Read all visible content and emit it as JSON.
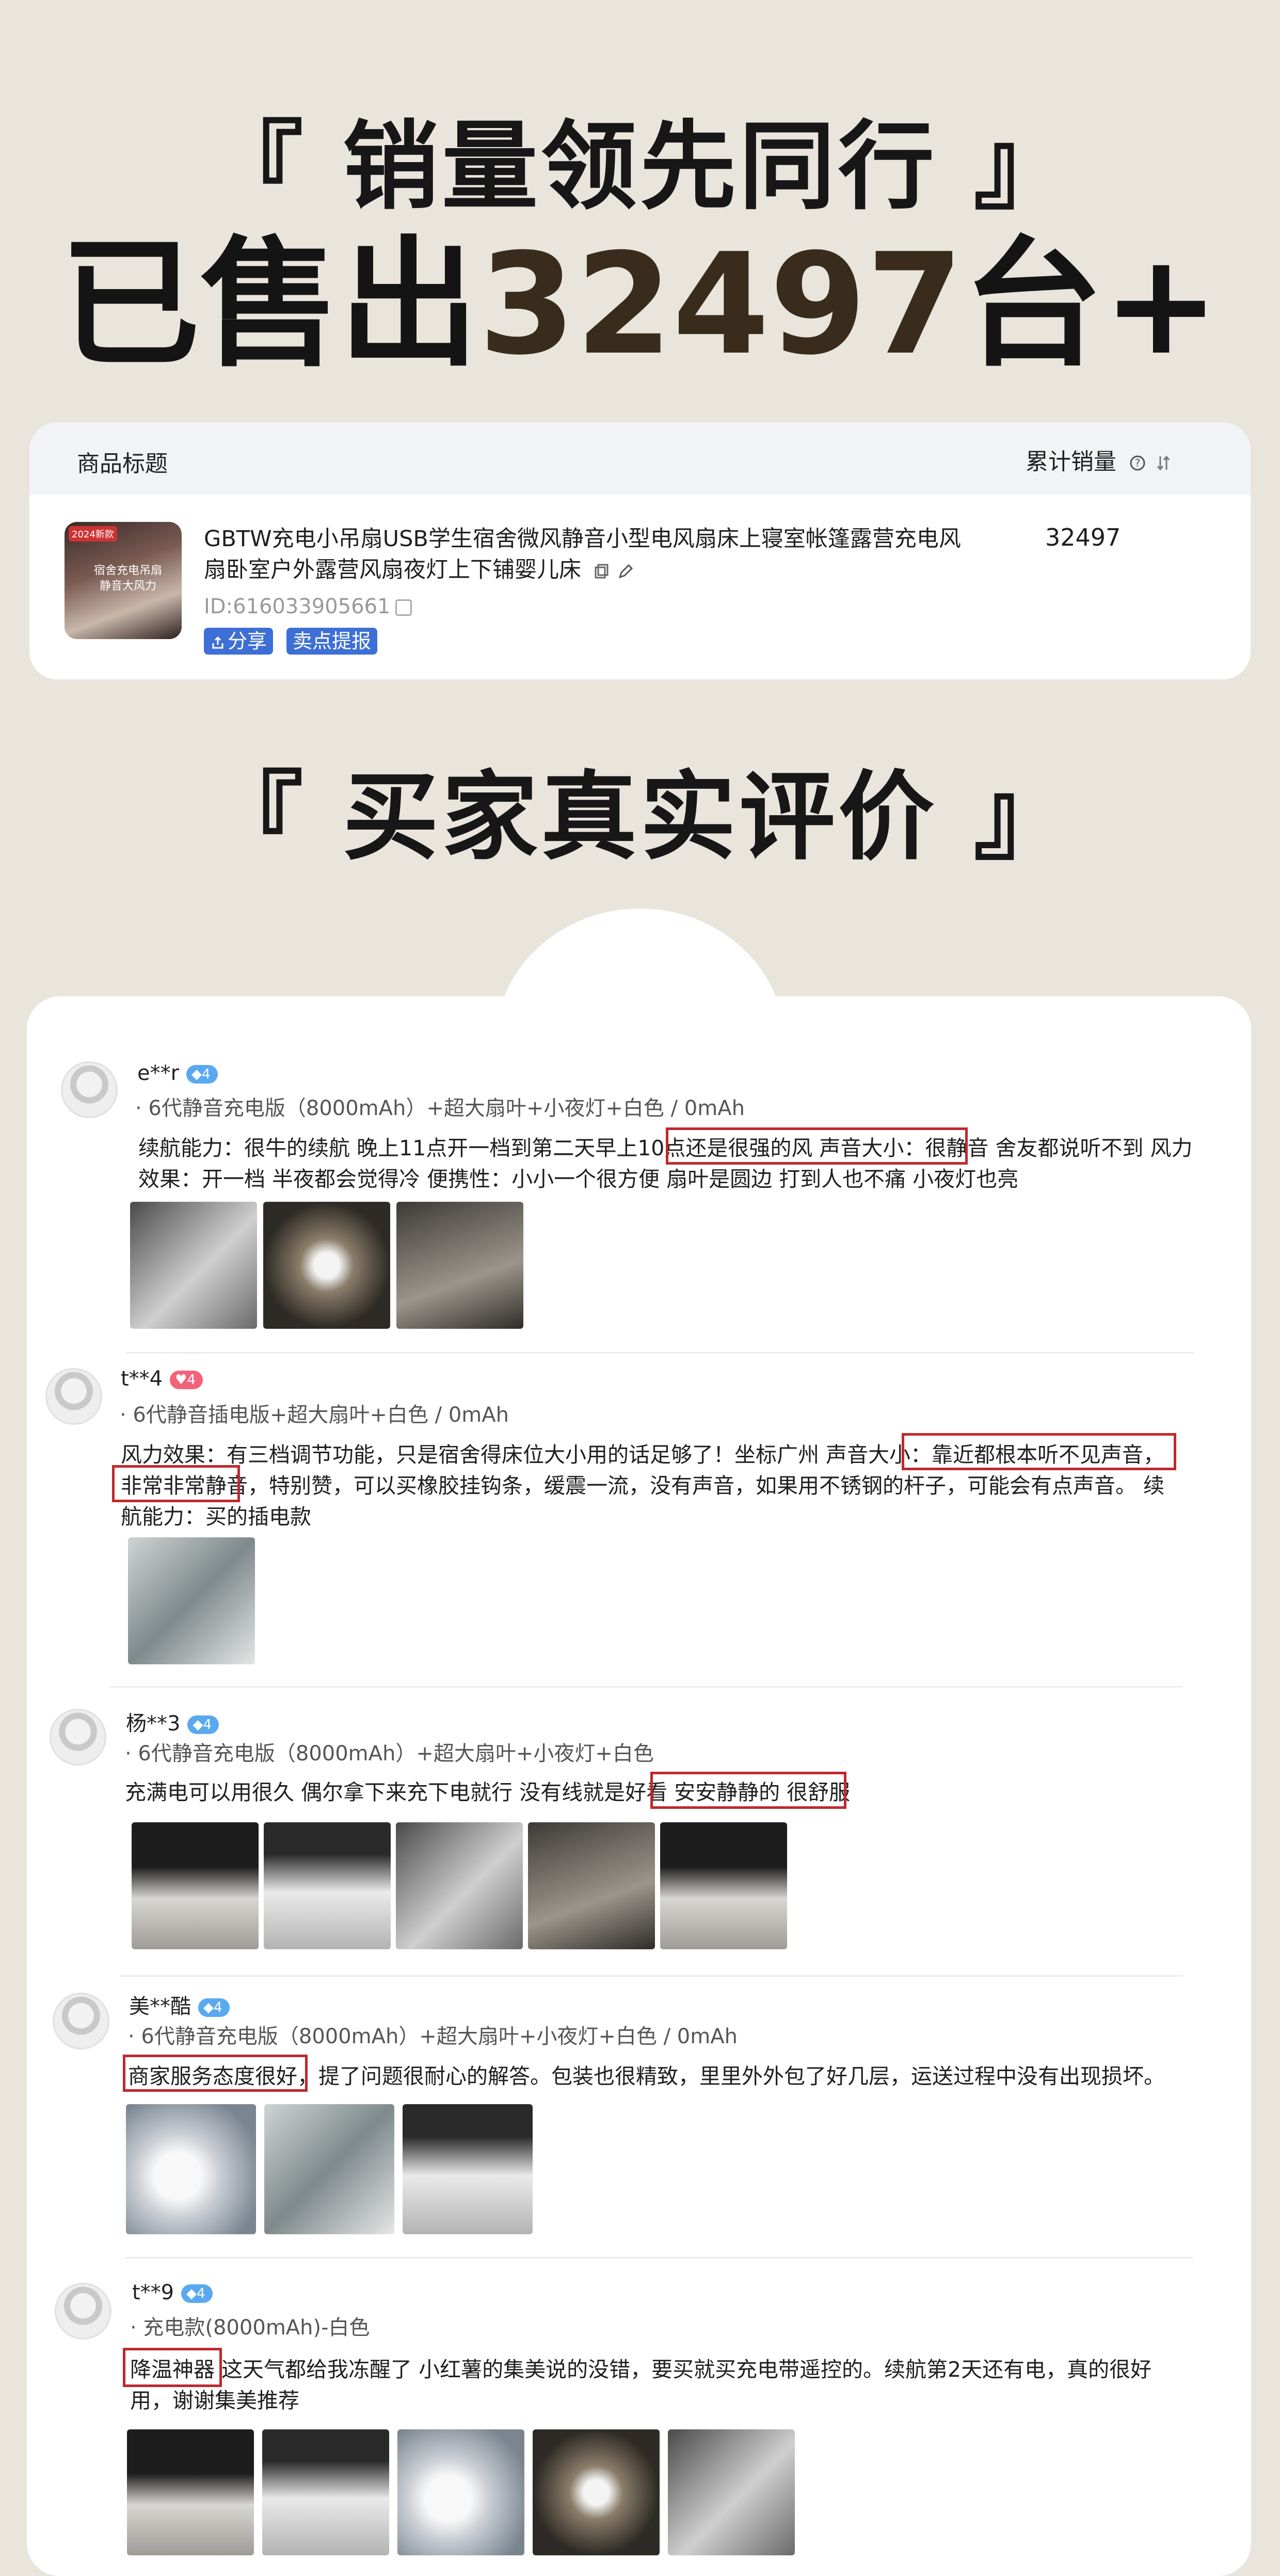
{
  "hero": {
    "subtitle": "『 销量领先同行 』",
    "main_prefix": "已售出",
    "main_number": "32497",
    "main_suffix": "台+"
  },
  "product": {
    "col_title": "商品标题",
    "col_sales": "累计销量",
    "sort_icon": "sort-icon",
    "help_icon": "help-circle-icon",
    "thumb_tag": "2024新款",
    "thumb_text": "宿舍充电吊扇 静音大风力",
    "title": "GBTW充电小吊扇USB学生宿舍微风静音小型电风扇床上寝室帐篷露营充电风扇卧室户外露营风扇夜灯上下铺婴儿床",
    "id": "ID:616033905661",
    "tags": [
      "分享",
      "卖点提报"
    ],
    "sales": "32497"
  },
  "reviews_title": "『 买家真实评价 』",
  "reviews": [
    {
      "user": "e**r",
      "level": "4",
      "spec": "· 6代静音充电版（8000mAh）+超大扇叶+小夜灯+白色 / 0mAh",
      "text": "续航能力：很牛的续航 晚上11点开一档到第二天早上10点还是很强的风 声音大小：很静音 舍友都说听不到 风力效果：开一档 半夜都会觉得冷 便携性：小小一个很方便 扇叶是圆边 打到人也不痛 小夜灯也亮"
    },
    {
      "user": "t**4",
      "level": "4",
      "spec": "· 6代静音插电版+超大扇叶+白色 / 0mAh",
      "text": "风力效果：有三档调节功能，只是宿舍得床位大小用的话足够了！坐标广州 声音大小：靠近都根本听不见声音，非常非常静音，特别赞，可以买橡胶挂钩条，缓震一流，没有声音，如果用不锈钢的杆子，可能会有点声音。 续航能力：买的插电款"
    },
    {
      "user": "杨**3",
      "level": "4",
      "spec": "· 6代静音充电版（8000mAh）+超大扇叶+小夜灯+白色",
      "text": "充满电可以用很久 偶尔拿下来充下电就行 没有线就是好看 安安静静的 很舒服"
    },
    {
      "user": "美**酷",
      "level": "4",
      "spec": "· 6代静音充电版（8000mAh）+超大扇叶+小夜灯+白色 / 0mAh",
      "text": "商家服务态度很好，提了问题很耐心的解答。包装也很精致，里里外外包了好几层，运送过程中没有出现损坏。"
    },
    {
      "user": "t**9",
      "level": "4",
      "spec": "· 充电款(8000mAh)-白色",
      "text": "降温神器 这天气都给我冻醒了 小红薯的集美说的没错，要买就买充电带遥控的。续航第2天还有电，真的很好用，谢谢集美推荐"
    }
  ]
}
